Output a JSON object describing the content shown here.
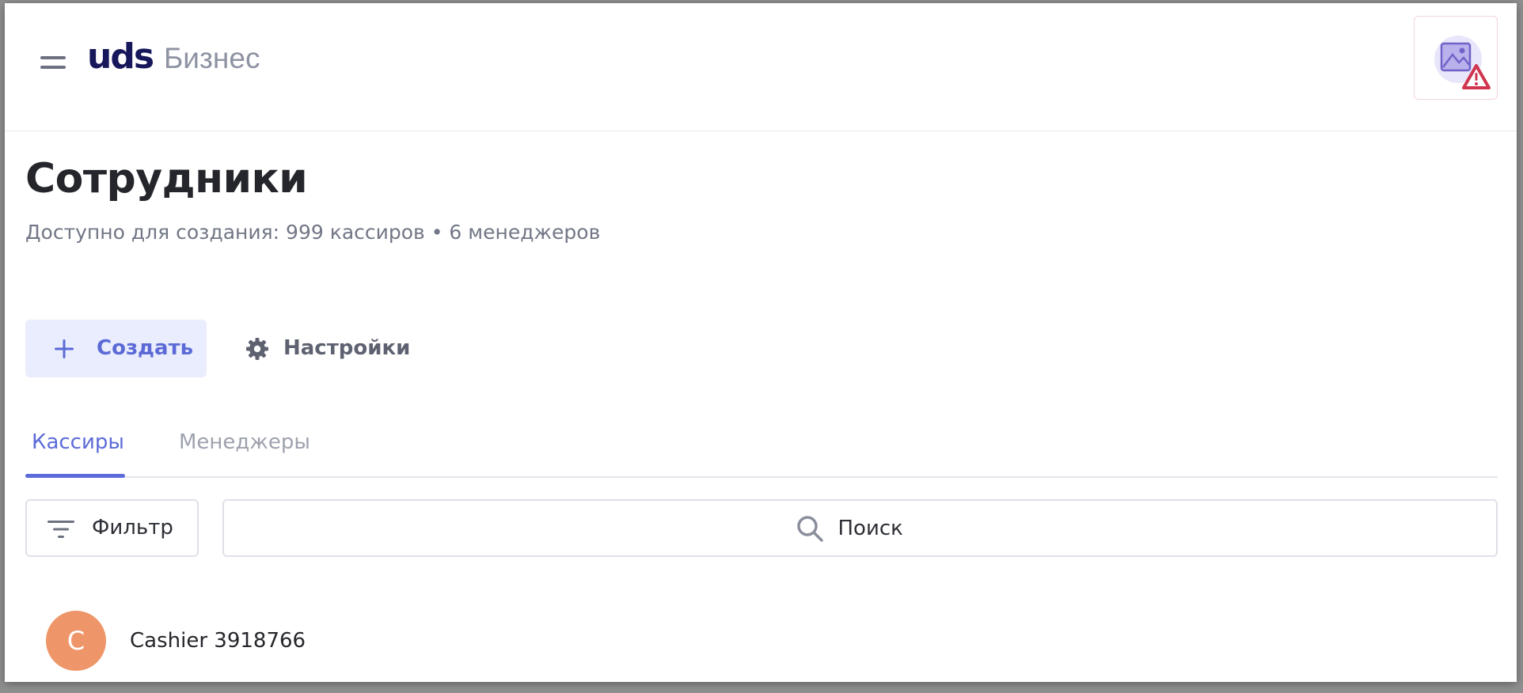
{
  "header": {
    "logo_mark": "uds",
    "logo_word": "Бизнес",
    "menu_icon": "hamburger-menu-icon",
    "avatar_icon": "broken-image-warning-icon"
  },
  "page": {
    "title": "Сотрудники",
    "subtitle": "Доступно для создания: 999 кассиров • 6 менеджеров"
  },
  "actions": {
    "create_label": "Создать",
    "create_icon": "plus-icon",
    "settings_label": "Настройки",
    "settings_icon": "gear-icon"
  },
  "tabs": [
    {
      "label": "Кассиры",
      "active": true
    },
    {
      "label": "Менеджеры",
      "active": false
    }
  ],
  "toolbar": {
    "filter_label": "Фильтр",
    "filter_icon": "filter-icon",
    "search_placeholder": "Поиск",
    "search_icon": "search-icon"
  },
  "employees": [
    {
      "initial": "C",
      "name": "Cashier 3918766",
      "avatar_color": "#ee966a"
    }
  ],
  "colors": {
    "accent": "#5c6bd9",
    "accent_bg": "#e9edfd",
    "logo": "#17185b",
    "warning": "#d0344f"
  }
}
